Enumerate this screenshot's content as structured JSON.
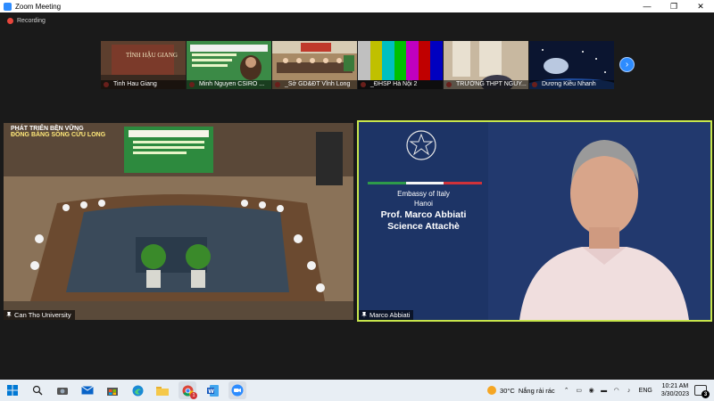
{
  "window": {
    "title": "Zoom Meeting",
    "controls": [
      "—",
      "❐",
      "✕"
    ]
  },
  "recording": {
    "label": "Recording"
  },
  "thumbnails": [
    {
      "name": "Tinh Hau Giang",
      "screen_text": "TỈNH HẬU GIANG",
      "color": "#5a3a2a"
    },
    {
      "name": "Minh Nguyen CSIRO ...",
      "color": "#2e7d3a"
    },
    {
      "name": "_Sở GD&ĐT Vĩnh Long",
      "color": "#8a6a4a"
    },
    {
      "name": "_ĐHSP Hà Nội 2",
      "color": "#7a7a7a"
    },
    {
      "name": "TRƯỜNG THPT NGUY...",
      "color": "#b8a48a"
    },
    {
      "name": "Dương Kiều Nhanh",
      "color": "#0e1a3a"
    }
  ],
  "main_videos": {
    "left": {
      "name": "Can Tho University",
      "banner_line1": "PHÁT TRIỂN BỀN VỮNG",
      "banner_line2": "ĐỒNG BẰNG SÔNG CỬU LONG"
    },
    "right": {
      "name": "Marco Abbiati",
      "line1": "Embassy of Italy",
      "line2": "Hanoi",
      "line3": "Prof. Marco Abbiati",
      "line4": "Science Attachè"
    }
  },
  "taskbar": {
    "apps": [
      "windows-logo",
      "search",
      "camera",
      "mail",
      "store",
      "edge",
      "file-explorer",
      "chrome",
      "word",
      "zoom"
    ],
    "chrome_badge": "1",
    "weather": {
      "temp": "30°C",
      "desc": "Nắng rải rác"
    },
    "language": "ENG",
    "time": "10:21 AM",
    "date": "3/30/2023",
    "notifications": "3"
  }
}
